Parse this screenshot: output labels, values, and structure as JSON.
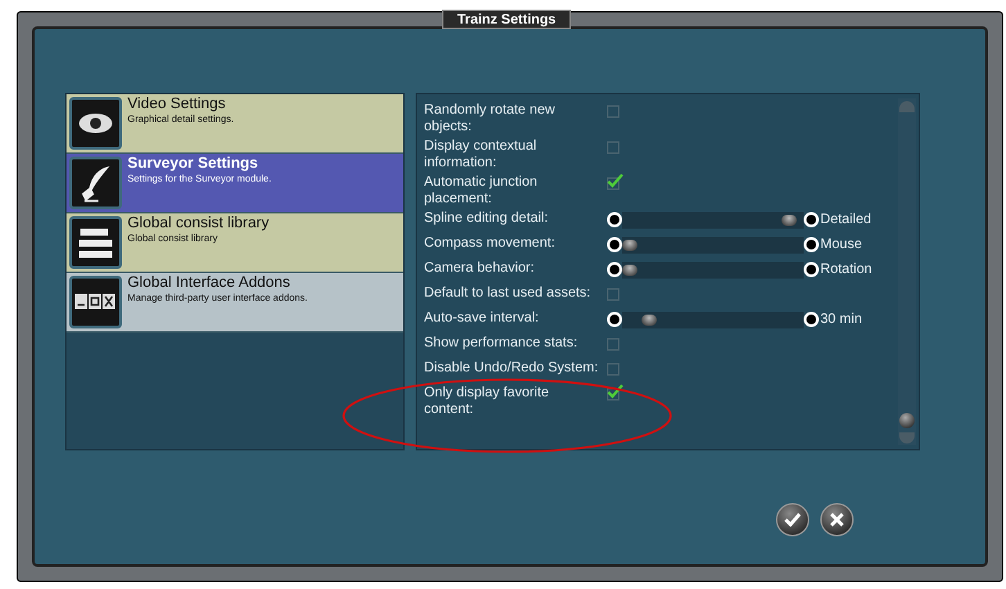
{
  "window": {
    "title": "Trainz Settings"
  },
  "categories": [
    {
      "title": "Video Settings",
      "subtitle": "Graphical detail settings.",
      "selected": false,
      "highlighted": false
    },
    {
      "title": "Surveyor Settings",
      "subtitle": "Settings for the Surveyor module.",
      "selected": true,
      "highlighted": false
    },
    {
      "title": "Global consist library",
      "subtitle": "Global consist library",
      "selected": false,
      "highlighted": false
    },
    {
      "title": "Global Interface Addons",
      "subtitle": "Manage third-party user interface addons.",
      "selected": false,
      "highlighted": true
    }
  ],
  "settings": [
    {
      "kind": "checkbox",
      "label": "Randomly rotate new\nobjects:",
      "checked": false
    },
    {
      "kind": "checkbox",
      "label": "Display contextual\ninformation:",
      "checked": false
    },
    {
      "kind": "checkbox",
      "label": "Automatic junction\nplacement:",
      "checked": true
    },
    {
      "kind": "slider",
      "label": "Spline editing detail:",
      "level": 0.96,
      "reading": "Detailed"
    },
    {
      "kind": "slider",
      "label": "Compass movement:",
      "level": 0.0,
      "reading": "Mouse"
    },
    {
      "kind": "slider",
      "label": "Camera behavior:",
      "level": 0.0,
      "reading": "Rotation"
    },
    {
      "kind": "checkbox",
      "label": "Default to last used assets:",
      "checked": false
    },
    {
      "kind": "slider",
      "label": "Auto-save interval:",
      "level": 0.12,
      "reading": "30 min"
    },
    {
      "kind": "checkbox",
      "label": "Show performance stats:",
      "checked": false
    },
    {
      "kind": "checkbox",
      "label": "Disable Undo/Redo System:",
      "checked": false
    },
    {
      "kind": "checkbox",
      "label": "Only display favorite\ncontent:",
      "checked": true
    }
  ]
}
